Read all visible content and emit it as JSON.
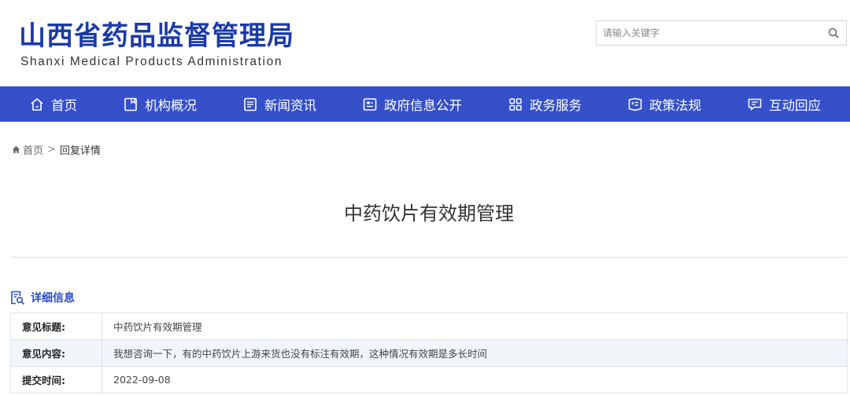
{
  "header": {
    "title_cn": "山西省药品监督管理局",
    "title_en": "Shanxi Medical Products Administration"
  },
  "search": {
    "placeholder": "请输入关键字",
    "icon": "search-icon"
  },
  "nav": {
    "items": [
      {
        "label": "首页",
        "icon": "home-icon"
      },
      {
        "label": "机构概况",
        "icon": "document-icon"
      },
      {
        "label": "新闻资讯",
        "icon": "news-icon"
      },
      {
        "label": "政府信息公开",
        "icon": "info-list-icon"
      },
      {
        "label": "政务服务",
        "icon": "grid-icon"
      },
      {
        "label": "政策法规",
        "icon": "regulation-icon"
      },
      {
        "label": "互动回应",
        "icon": "chat-icon"
      }
    ]
  },
  "breadcrumb": {
    "home": "首页",
    "separator": ">",
    "current": "回复详情"
  },
  "page_title": "中药饮片有效期管理",
  "detail": {
    "heading": "详细信息",
    "rows": [
      {
        "key": "意见标题:",
        "value": "中药饮片有效期管理"
      },
      {
        "key": "意见内容:",
        "value": "我想咨询一下，有的中药饮片上游来货也没有标注有效期，这种情况有效期是多长时间"
      },
      {
        "key": "提交时间:",
        "value": "2022-09-08"
      }
    ]
  },
  "colors": {
    "brand_blue": "#1a3aa8",
    "nav_bg": "#3650c9",
    "accent_blue": "#2a4cc9",
    "row_alt_bg": "#f2f6fb"
  }
}
